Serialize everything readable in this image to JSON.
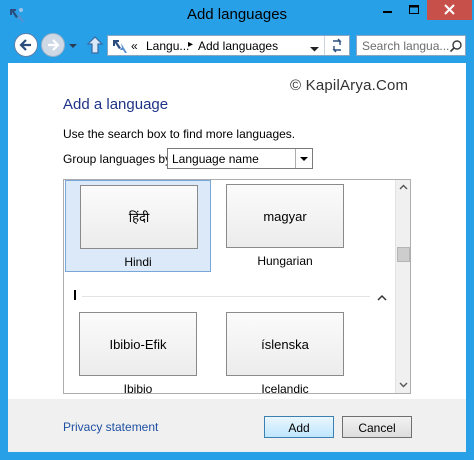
{
  "window": {
    "title": "Add languages",
    "accent": "#28a0e8",
    "close_color": "#c7504b"
  },
  "address_bar": {
    "overflow": "«",
    "crumbs": [
      "Langu...",
      "Add languages"
    ],
    "separator": "▸"
  },
  "search": {
    "placeholder": "Search langua..."
  },
  "watermark": "© KapilArya.Com",
  "content": {
    "heading": "Add a language",
    "instructions": "Use the search box to find more languages.",
    "group_label": "Group languages by:",
    "group_value": "Language name"
  },
  "languages": [
    {
      "native": "हिंदी",
      "name": "Hindi",
      "selected": true
    },
    {
      "native": "magyar",
      "name": "Hungarian",
      "selected": false
    },
    {
      "native": "Ibibio-Efik",
      "name": "Ibibio",
      "selected": false
    },
    {
      "native": "íslenska",
      "name": "Icelandic",
      "selected": false
    }
  ],
  "group_header": "I",
  "footer": {
    "privacy": "Privacy statement",
    "add": "Add",
    "cancel": "Cancel"
  },
  "icons": [
    "app-icon",
    "minimize-icon",
    "maximize-icon",
    "close-icon",
    "back-arrow-icon",
    "forward-arrow-icon",
    "chevron-down-icon",
    "up-arrow-icon",
    "refresh-icon",
    "search-icon",
    "collapse-chevron-icon"
  ]
}
